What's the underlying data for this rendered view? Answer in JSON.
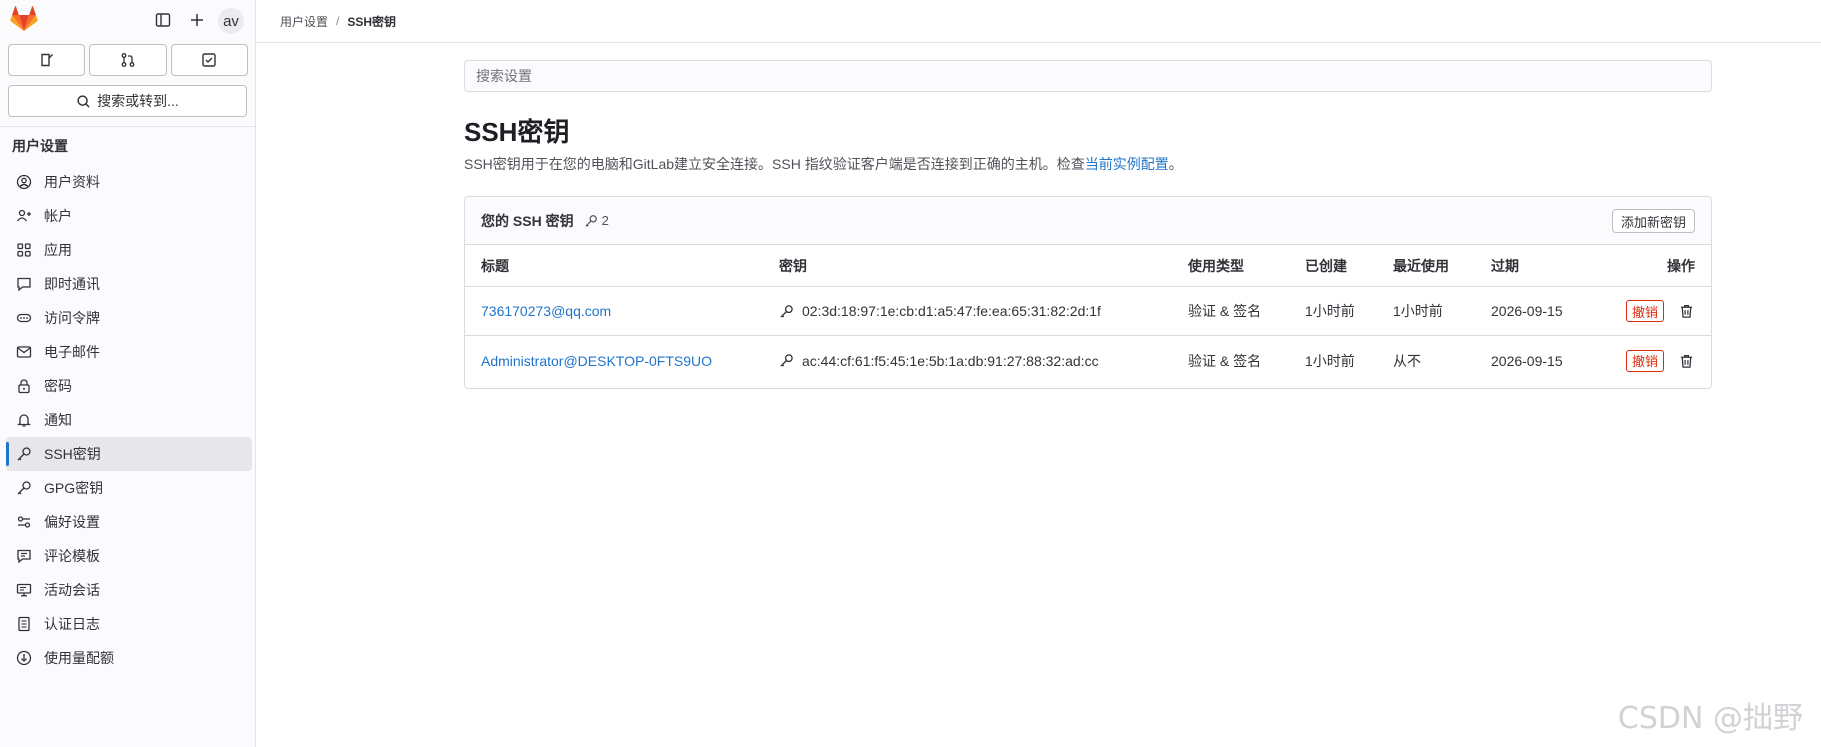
{
  "sidebar": {
    "avatar_text": "av",
    "search_label": "搜索或转到...",
    "section_title": "用户设置",
    "items": [
      {
        "label": "用户资料",
        "icon": "profile-icon"
      },
      {
        "label": "帐户",
        "icon": "account-icon"
      },
      {
        "label": "应用",
        "icon": "applications-icon"
      },
      {
        "label": "即时通讯",
        "icon": "chat-icon"
      },
      {
        "label": "访问令牌",
        "icon": "token-icon"
      },
      {
        "label": "电子邮件",
        "icon": "mail-icon"
      },
      {
        "label": "密码",
        "icon": "lock-icon"
      },
      {
        "label": "通知",
        "icon": "bell-icon"
      },
      {
        "label": "SSH密钥",
        "icon": "key-icon",
        "active": true
      },
      {
        "label": "GPG密钥",
        "icon": "key-icon"
      },
      {
        "label": "偏好设置",
        "icon": "preferences-icon"
      },
      {
        "label": "评论模板",
        "icon": "comment-icon"
      },
      {
        "label": "活动会话",
        "icon": "monitor-icon"
      },
      {
        "label": "认证日志",
        "icon": "log-icon"
      },
      {
        "label": "使用量配额",
        "icon": "quota-icon"
      }
    ]
  },
  "breadcrumb": {
    "parent": "用户设置",
    "separator": "/",
    "current": "SSH密钥"
  },
  "search": {
    "placeholder": "搜索设置"
  },
  "page": {
    "title": "SSH密钥",
    "description": "SSH密钥用于在您的电脑和GitLab建立安全连接。SSH 指纹验证客户端是否连接到正确的主机。检查",
    "description_link": "当前实例配置",
    "description_end": "。"
  },
  "card": {
    "title": "您的 SSH 密钥",
    "count": "2",
    "add_button": "添加新密钥",
    "headers": {
      "title": "标题",
      "key": "密钥",
      "usage": "使用类型",
      "created": "已创建",
      "last_used": "最近使用",
      "expires": "过期",
      "actions": "操作"
    },
    "rows": [
      {
        "title": "736170273@qq.com",
        "fingerprint": "02:3d:18:97:1e:cb:d1:a5:47:fe:ea:65:31:82:2d:1f",
        "usage": "验证 & 签名",
        "created": "1小时前",
        "last_used": "1小时前",
        "expires": "2026-09-15",
        "revoke": "撤销"
      },
      {
        "title": "Administrator@DESKTOP-0FTS9UO",
        "fingerprint": "ac:44:cf:61:f5:45:1e:5b:1a:db:91:27:88:32:ad:cc",
        "usage": "验证 & 签名",
        "created": "1小时前",
        "last_used": "从不",
        "expires": "2026-09-15",
        "revoke": "撤销"
      }
    ]
  },
  "watermark": "CSDN @拙野",
  "colors": {
    "link": "#1f75cb",
    "danger": "#dd2b0e",
    "active_bg": "#e7e6ea",
    "logo": "#e24329"
  }
}
